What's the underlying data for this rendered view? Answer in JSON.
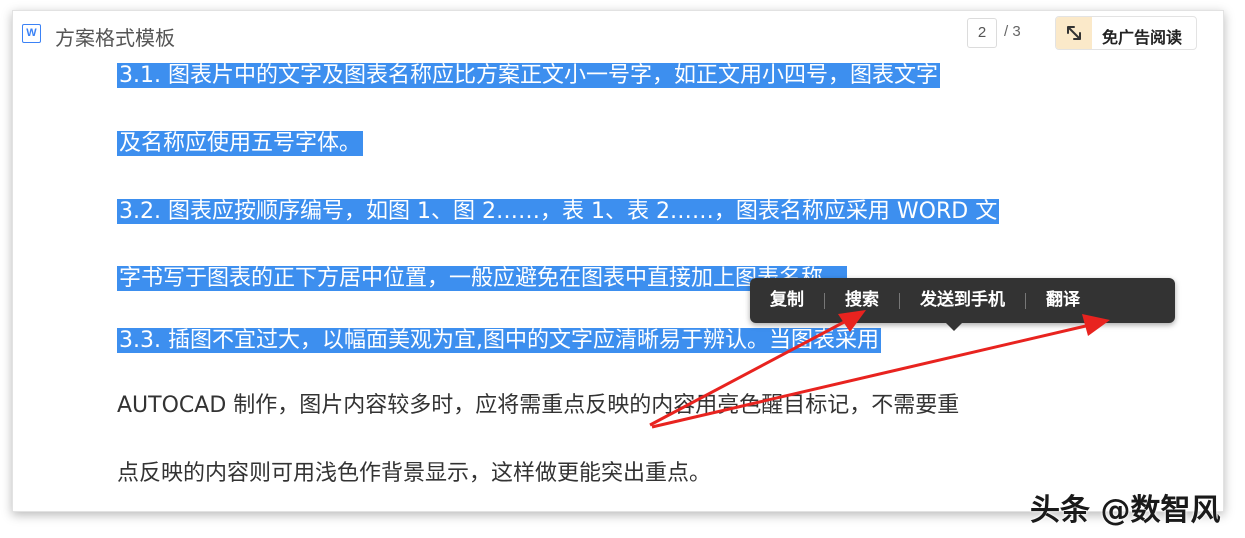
{
  "header": {
    "doc_icon": "W",
    "title": "方案格式模板",
    "page_current": "2",
    "page_total": "/ 3",
    "noad_icon": "resize-arrows-icon",
    "noad_label": "免广告阅读"
  },
  "content": {
    "line1": "3.1. 图表片中的文字及图表名称应比方案正文小一号字，如正文用小四号，图表文字",
    "line2": "及名称应使用五号字体。",
    "line3": "3.2. 图表应按顺序编号，如图 1、图 2……，表 1、表 2……，图表名称应采用 WORD 文",
    "line4": "字书写于图表的正下方居中位置，一般应避免在图表中直接加上图表名称。",
    "line5": "3.3. 插图不宜过大，以幅面美观为宜,图中的文字应清晰易于辨认。当图表采用",
    "line6": "AUTOCAD 制作，图片内容较多时，应将需重点反映的内容用亮色醒目标记，不需要重",
    "line7": "点反映的内容则可用浅色作背景显示，这样做更能突出重点。"
  },
  "context_menu": {
    "items": [
      "复制",
      "搜索",
      "发送到手机",
      "翻译"
    ]
  },
  "annotation": {
    "arrow_color": "#e8231f",
    "arrow_targets": [
      "搜索",
      "翻译"
    ]
  },
  "watermark": "头条 @数智风",
  "colors": {
    "selection": "#3d8fef",
    "menu_bg": "#333333",
    "noad_bg": "#fbe9c9"
  }
}
